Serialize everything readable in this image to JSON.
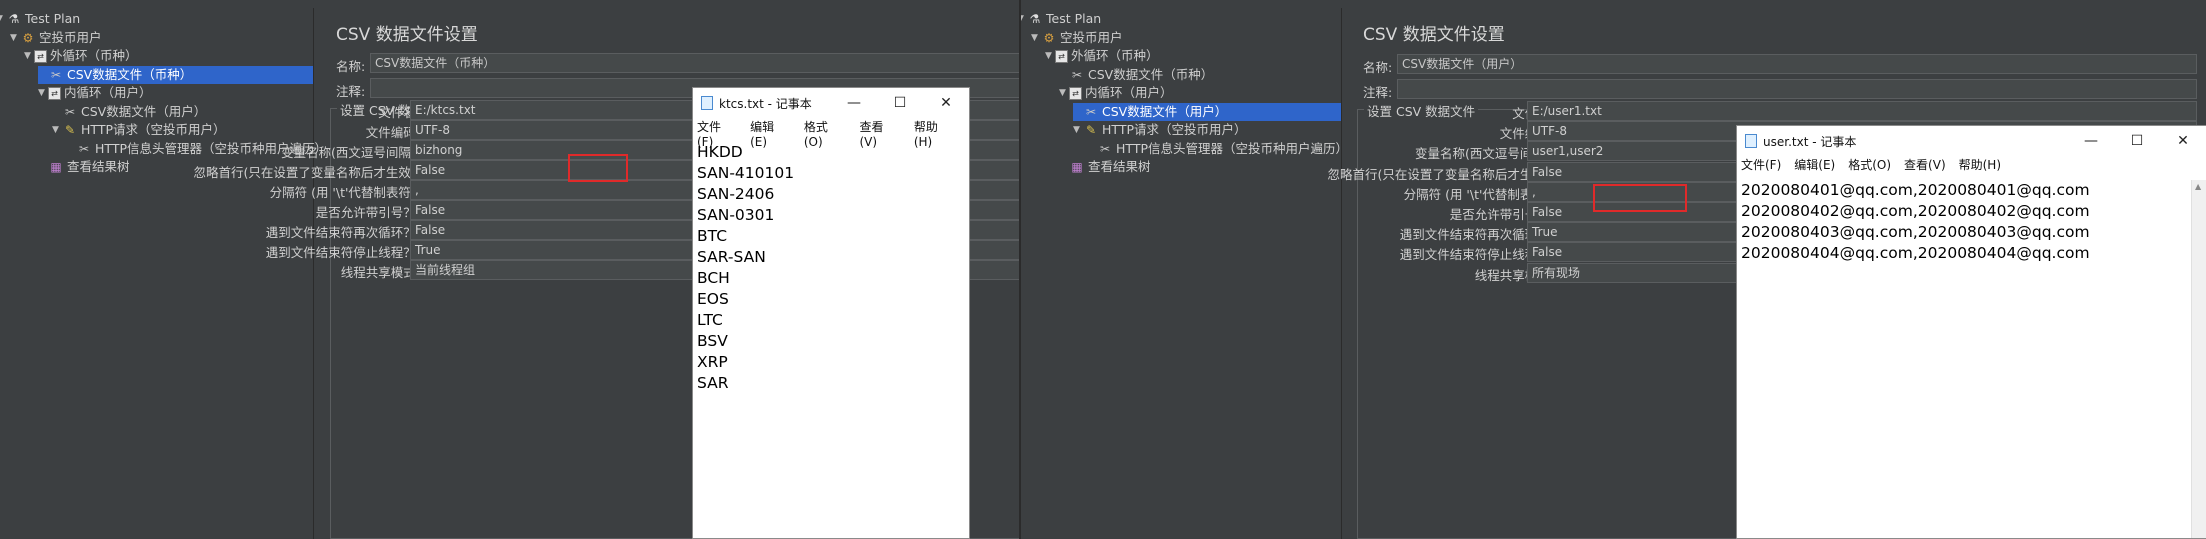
{
  "left": {
    "tree": [
      {
        "label": "Test Plan",
        "icon": "plan",
        "level": 0,
        "toggle": "▼"
      },
      {
        "label": "空投币用户",
        "icon": "users",
        "level": 1,
        "toggle": "▼"
      },
      {
        "label": "外循环（币种）",
        "icon": "loop",
        "level": 2,
        "toggle": "▼"
      },
      {
        "label": "CSV数据文件（币种）",
        "icon": "csv",
        "level": 3,
        "toggle": "",
        "selected": true
      },
      {
        "label": "内循环（用户）",
        "icon": "loop",
        "level": 3,
        "toggle": "▼"
      },
      {
        "label": "CSV数据文件（用户）",
        "icon": "csv",
        "level": 4,
        "toggle": ""
      },
      {
        "label": "HTTP请求（空投币用户）",
        "icon": "http",
        "level": 4,
        "toggle": "▼"
      },
      {
        "label": "HTTP信息头管理器（空投币种用户遍历）",
        "icon": "csv",
        "level": 5,
        "toggle": ""
      },
      {
        "label": "查看结果树",
        "icon": "result",
        "level": 3,
        "toggle": ""
      }
    ],
    "title": "CSV 数据文件设置",
    "name_label": "名称:",
    "name_value": "CSV数据文件（币种）",
    "comment_label": "注释:",
    "group_label": "设置 CSV 数据文件",
    "rows": [
      {
        "label": "文件名:",
        "value": "E:/ktcs.txt"
      },
      {
        "label": "文件编码:",
        "value": "UTF-8"
      },
      {
        "label": "变量名称(西文逗号间隔):",
        "value": "bizhong"
      },
      {
        "label": "忽略首行(只在设置了变量名称后才生效):",
        "value": "False"
      },
      {
        "label": "分隔符 (用 '\\t'代替制表符):",
        "value": ","
      },
      {
        "label": "是否允许带引号？:",
        "value": "False"
      },
      {
        "label": "遇到文件结束符再次循环？:",
        "value": "False"
      },
      {
        "label": "遇到文件结束符停止线程？:",
        "value": "True"
      },
      {
        "label": "线程共享模式:",
        "value": "当前线程组"
      }
    ],
    "notepad": {
      "title": "ktcs.txt - 记事本",
      "menu": [
        "文件(F)",
        "编辑(E)",
        "格式(O)",
        "查看(V)",
        "帮助(H)"
      ],
      "lines": [
        "HKDD",
        "SAN-410101",
        "SAN-2406",
        "SAN-0301",
        "BTC",
        "SAR-SAN",
        "BCH",
        "EOS",
        "LTC",
        "BSV",
        "XRP",
        "SAR"
      ]
    }
  },
  "right": {
    "tree": [
      {
        "label": "Test Plan",
        "icon": "plan",
        "level": 0,
        "toggle": "▼"
      },
      {
        "label": "空投币用户",
        "icon": "users",
        "level": 1,
        "toggle": "▼"
      },
      {
        "label": "外循环（币种）",
        "icon": "loop",
        "level": 2,
        "toggle": "▼"
      },
      {
        "label": "CSV数据文件（币种）",
        "icon": "csv",
        "level": 3,
        "toggle": ""
      },
      {
        "label": "内循环（用户）",
        "icon": "loop",
        "level": 3,
        "toggle": "▼"
      },
      {
        "label": "CSV数据文件（用户）",
        "icon": "csv",
        "level": 4,
        "toggle": "",
        "selected": true
      },
      {
        "label": "HTTP请求（空投币用户）",
        "icon": "http",
        "level": 4,
        "toggle": "▼"
      },
      {
        "label": "HTTP信息头管理器（空投币种用户遍历）",
        "icon": "csv",
        "level": 5,
        "toggle": ""
      },
      {
        "label": "查看结果树",
        "icon": "result",
        "level": 3,
        "toggle": ""
      }
    ],
    "title": "CSV 数据文件设置",
    "name_label": "名称:",
    "name_value": "CSV数据文件（用户）",
    "comment_label": "注释:",
    "group_label": "设置 CSV 数据文件",
    "rows": [
      {
        "label": "文件名:",
        "value": "E:/user1.txt"
      },
      {
        "label": "文件编码:",
        "value": "UTF-8"
      },
      {
        "label": "变量名称(西文逗号间隔):",
        "value": "user1,user2"
      },
      {
        "label": "忽略首行(只在设置了变量名称后才生效):",
        "value": "False"
      },
      {
        "label": "分隔符 (用 '\\t'代替制表符):",
        "value": ","
      },
      {
        "label": "是否允许带引号？:",
        "value": "False"
      },
      {
        "label": "遇到文件结束符再次循环？:",
        "value": "True"
      },
      {
        "label": "遇到文件结束符停止线程？:",
        "value": "False"
      },
      {
        "label": "线程共享模式:",
        "value": "所有现场"
      }
    ],
    "notepad": {
      "title": "user.txt - 记事本",
      "menu": [
        "文件(F)",
        "编辑(E)",
        "格式(O)",
        "查看(V)",
        "帮助(H)"
      ],
      "lines": [
        "2020080401@qq.com,2020080401@qq.com",
        "2020080402@qq.com,2020080402@qq.com",
        "2020080403@qq.com,2020080403@qq.com",
        "2020080404@qq.com,2020080404@qq.com"
      ]
    }
  },
  "icons": {
    "plan": "flask-icon",
    "users": "gear-icon",
    "loop": "loop-icon",
    "csv": "scissors-icon",
    "http": "pen-icon",
    "result": "chart-icon"
  },
  "colors": {
    "selection": "#2f65ca",
    "highlight": "#e02a2a",
    "background": "#3c3f41"
  }
}
